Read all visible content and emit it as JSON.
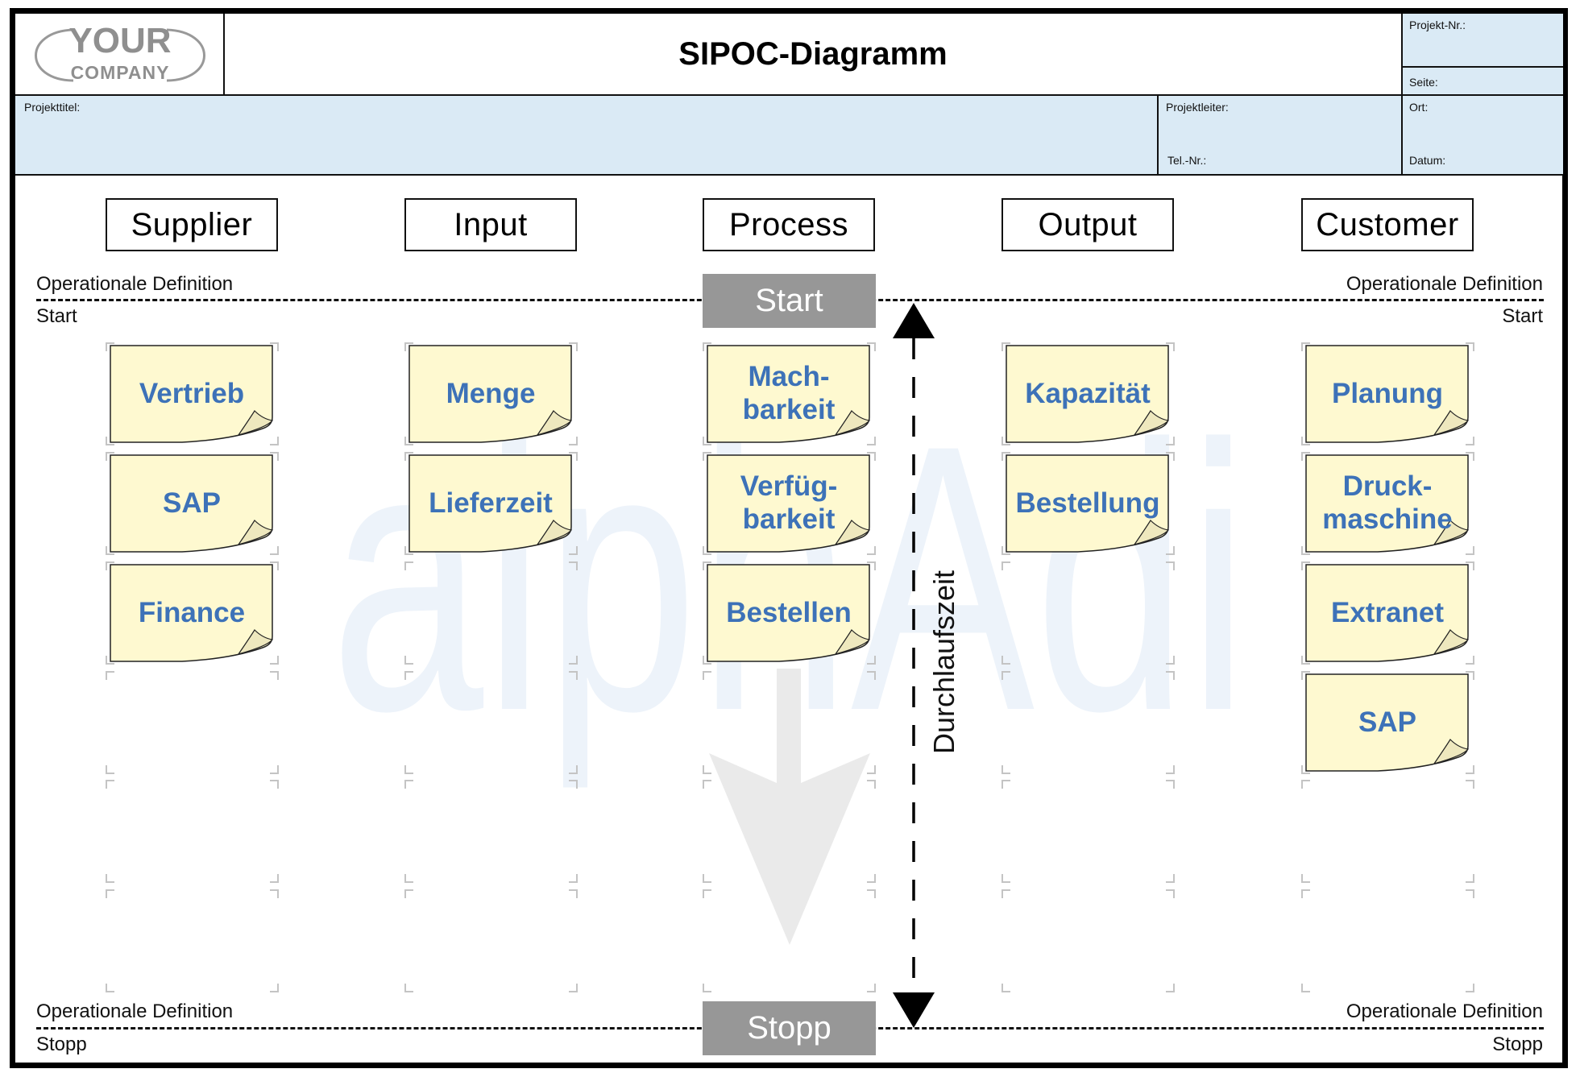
{
  "header": {
    "logo_line1": "YOUR",
    "logo_line2": "COMPANY",
    "title": "SIPOC-Diagramm",
    "projekt_nr_label": "Projekt-Nr.:",
    "seite_label": "Seite:",
    "projekttitel_label": "Projekttitel:",
    "projektleiter_label": "Projektleiter:",
    "tel_label": "Tel.-Nr.:",
    "ort_label": "Ort:",
    "datum_label": "Datum:"
  },
  "columns": [
    {
      "label": "Supplier",
      "notes": [
        "Vertrieb",
        "SAP",
        "Finance"
      ]
    },
    {
      "label": "Input",
      "notes": [
        "Menge",
        "Lieferzeit"
      ]
    },
    {
      "label": "Process",
      "notes": [
        "Mach-\nbarkeit",
        "Verfüg-\nbarkeit",
        "Bestellen"
      ]
    },
    {
      "label": "Output",
      "notes": [
        "Kapazität",
        "Bestellung"
      ]
    },
    {
      "label": "Customer",
      "notes": [
        "Planung",
        "Druck-\nmaschine",
        "Extranet",
        "SAP"
      ]
    }
  ],
  "boundaries": {
    "start": {
      "definition_left": "Operationale Definition",
      "sub_left": "Start",
      "definition_right": "Operationale Definition",
      "sub_right": "Start",
      "box_label": "Start"
    },
    "stop": {
      "definition_left": "Operationale Definition",
      "sub_left": "Stopp",
      "definition_right": "Operationale Definition",
      "sub_right": "Stopp",
      "box_label": "Stopp"
    }
  },
  "cycle_time_label": "Durchlaufszeit",
  "watermark_text": "alphAdi",
  "colors": {
    "note_fill": "#FEF9D0",
    "note_text": "#3D72B8",
    "info_fill": "#DAEAF5",
    "boundary_box": "#979797",
    "watermark": "#EDF3FA",
    "flow_arrow": "#EAEAEA"
  }
}
